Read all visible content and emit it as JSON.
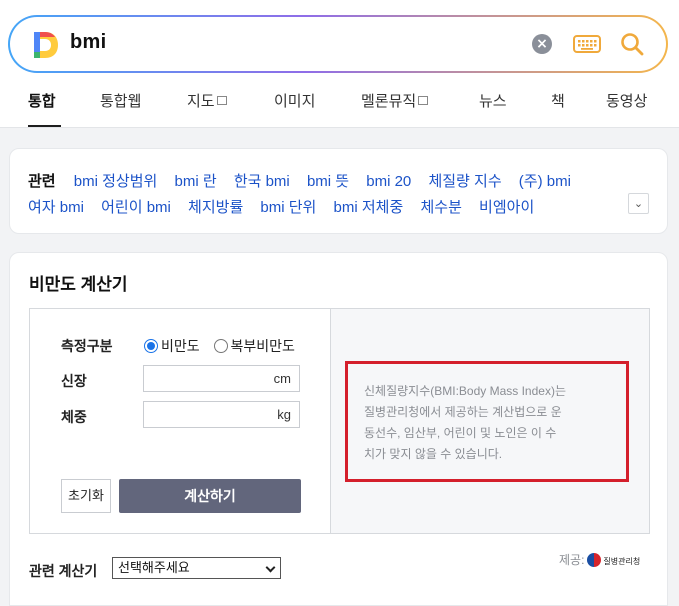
{
  "search": {
    "query": "bmi",
    "clear_icon": "close-circle-icon",
    "keyboard_icon": "keyboard-icon",
    "search_icon": "magnifier-icon",
    "logo": "daum-logo"
  },
  "tabs": [
    {
      "label": "통합",
      "active": true
    },
    {
      "label": "통합웹"
    },
    {
      "label": "지도",
      "external": true
    },
    {
      "label": "이미지"
    },
    {
      "label": "멜론뮤직",
      "external": true
    },
    {
      "label": "뉴스"
    },
    {
      "label": "책"
    },
    {
      "label": "동영상"
    }
  ],
  "related": {
    "label": "관련",
    "row1": [
      "bmi 정상범위",
      "bmi 란",
      "한국 bmi",
      "bmi 뜻",
      "bmi 20",
      "체질량 지수",
      "(주) bmi"
    ],
    "row2": [
      "여자 bmi",
      "어린이 bmi",
      "체지방률",
      "bmi 단위",
      "bmi 저체중",
      "체수분",
      "비엠아이"
    ],
    "more_icon": "chevron-down-icon"
  },
  "calculator": {
    "title": "비만도 계산기",
    "measure_label": "측정구분",
    "options": [
      "비만도",
      "복부비만도"
    ],
    "selected_option": "비만도",
    "height_label": "신장",
    "height_unit": "cm",
    "weight_label": "체중",
    "weight_unit": "kg",
    "reset_label": "초기화",
    "calc_label": "계산하기",
    "info_lines": [
      "신체질량지수(BMI:Body Mass Index)는",
      "질병관리청에서 제공하는 계산법으로 운",
      "동선수, 임산부, 어린이 및 노인은 이 수",
      "치가 맞지 않을 수 있습니다."
    ],
    "provider_label": "제공:",
    "provider_name": "질병관리청",
    "related_calc_label": "관련 계산기",
    "related_calc_select": "선택해주세요"
  },
  "colors": {
    "link": "#1c53c8",
    "highlight_border": "#d41f2c",
    "calc_button": "#62667c",
    "radio_selected": "#1a73e8"
  }
}
